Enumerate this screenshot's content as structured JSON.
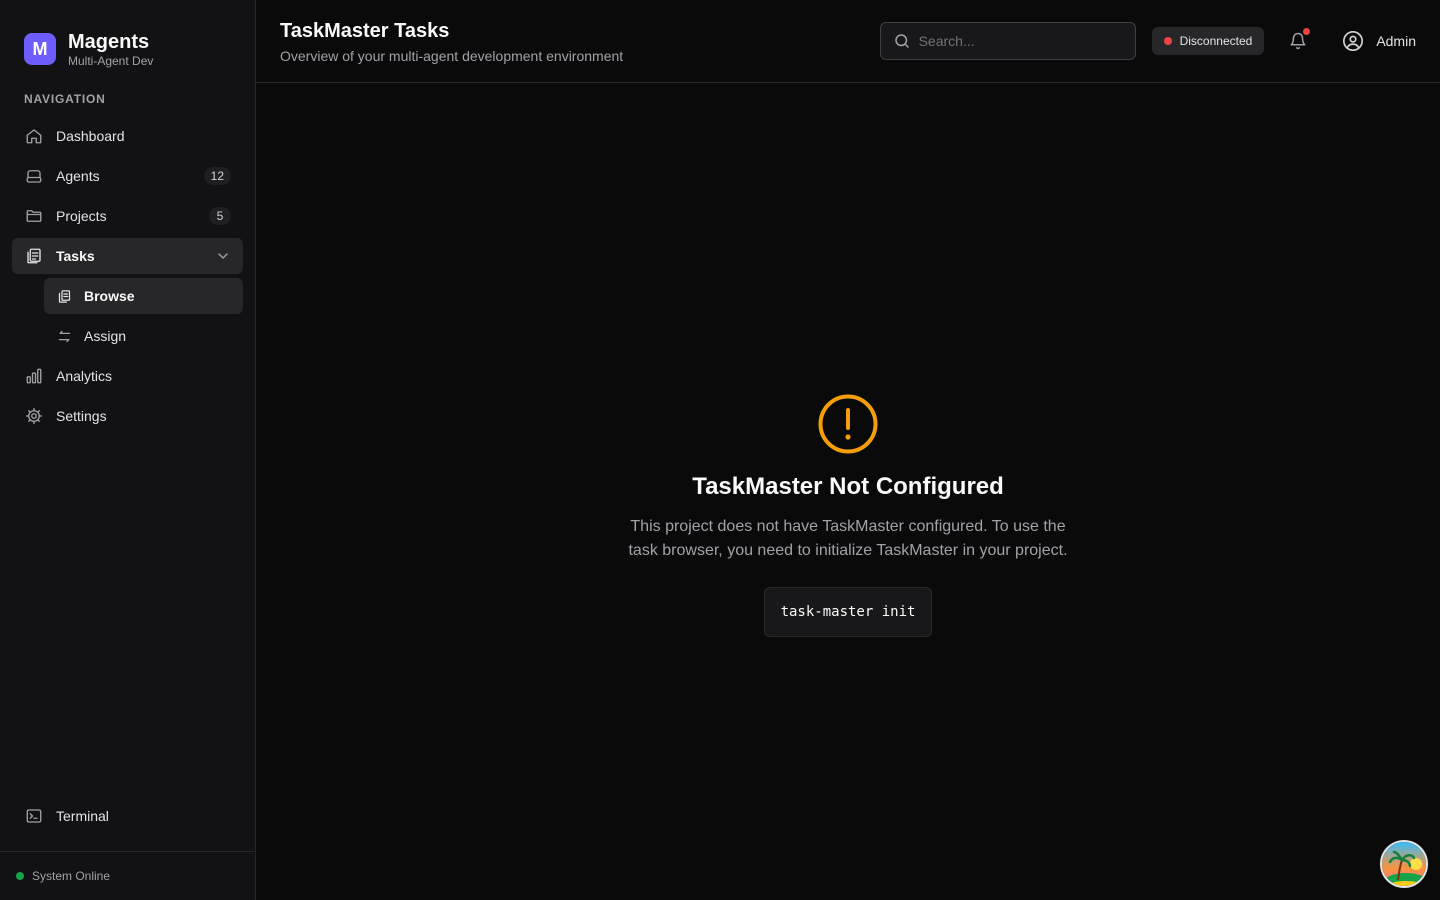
{
  "brand": {
    "logo_letter": "M",
    "name": "Magents",
    "subtitle": "Multi-Agent Dev"
  },
  "sidebar": {
    "heading": "NAVIGATION",
    "items": [
      {
        "label": "Dashboard",
        "icon": "home-icon"
      },
      {
        "label": "Agents",
        "icon": "agents-icon",
        "badge": "12"
      },
      {
        "label": "Projects",
        "icon": "folder-icon",
        "badge": "5"
      },
      {
        "label": "Tasks",
        "icon": "clipboard-icon",
        "expanded": true,
        "children": [
          {
            "label": "Browse",
            "icon": "copy-icon",
            "active": true
          },
          {
            "label": "Assign",
            "icon": "arrows-icon"
          }
        ]
      },
      {
        "label": "Analytics",
        "icon": "bar-chart-icon"
      },
      {
        "label": "Settings",
        "icon": "gear-icon"
      }
    ],
    "terminal_label": "Terminal",
    "system_status": "System Online"
  },
  "header": {
    "title": "TaskMaster Tasks",
    "subtitle": "Overview of your multi-agent development environment",
    "search_placeholder": "Search...",
    "connection_status": "Disconnected",
    "user_name": "Admin"
  },
  "empty_state": {
    "title": "TaskMaster Not Configured",
    "description": "This project does not have TaskMaster configured. To use the task browser, you need to initialize TaskMaster in your project.",
    "command": "task-master init"
  },
  "colors": {
    "accent": "#6d5dfc",
    "warning": "#f59e0b",
    "danger": "#ef4444",
    "success": "#16a34a"
  }
}
